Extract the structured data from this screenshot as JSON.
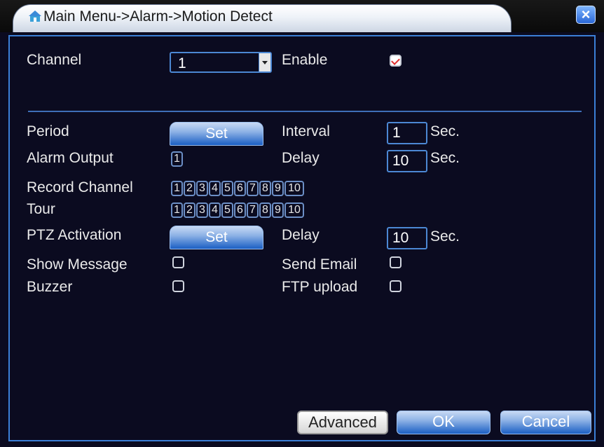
{
  "window": {
    "title": "Main Menu->Alarm->Motion Detect",
    "close_symbol": "×"
  },
  "channel": {
    "label": "Channel",
    "value": "1"
  },
  "enable": {
    "label": "Enable",
    "checked": true
  },
  "period": {
    "label": "Period",
    "button": "Set"
  },
  "interval": {
    "label": "Interval",
    "value": "1",
    "unit": "Sec."
  },
  "alarm_output": {
    "label": "Alarm Output",
    "items": [
      "1"
    ]
  },
  "delay1": {
    "label": "Delay",
    "value": "10",
    "unit": "Sec."
  },
  "record_channel": {
    "label": "Record Channel",
    "items": [
      "1",
      "2",
      "3",
      "4",
      "5",
      "6",
      "7",
      "8",
      "9",
      "10"
    ]
  },
  "tour": {
    "label": "Tour",
    "items": [
      "1",
      "2",
      "3",
      "4",
      "5",
      "6",
      "7",
      "8",
      "9",
      "10"
    ]
  },
  "ptz": {
    "label": "PTZ Activation",
    "button": "Set"
  },
  "delay2": {
    "label": "Delay",
    "value": "10",
    "unit": "Sec."
  },
  "show_message": {
    "label": "Show Message",
    "checked": false
  },
  "send_email": {
    "label": "Send Email",
    "checked": false
  },
  "buzzer": {
    "label": "Buzzer",
    "checked": false
  },
  "ftp_upload": {
    "label": "FTP upload",
    "checked": false
  },
  "footer": {
    "advanced": "Advanced",
    "ok": "OK",
    "cancel": "Cancel"
  },
  "colors": {
    "background": "#0b0b20",
    "border": "#3b7fd6",
    "text": "#eaeaea",
    "check_mark": "#e03030"
  }
}
